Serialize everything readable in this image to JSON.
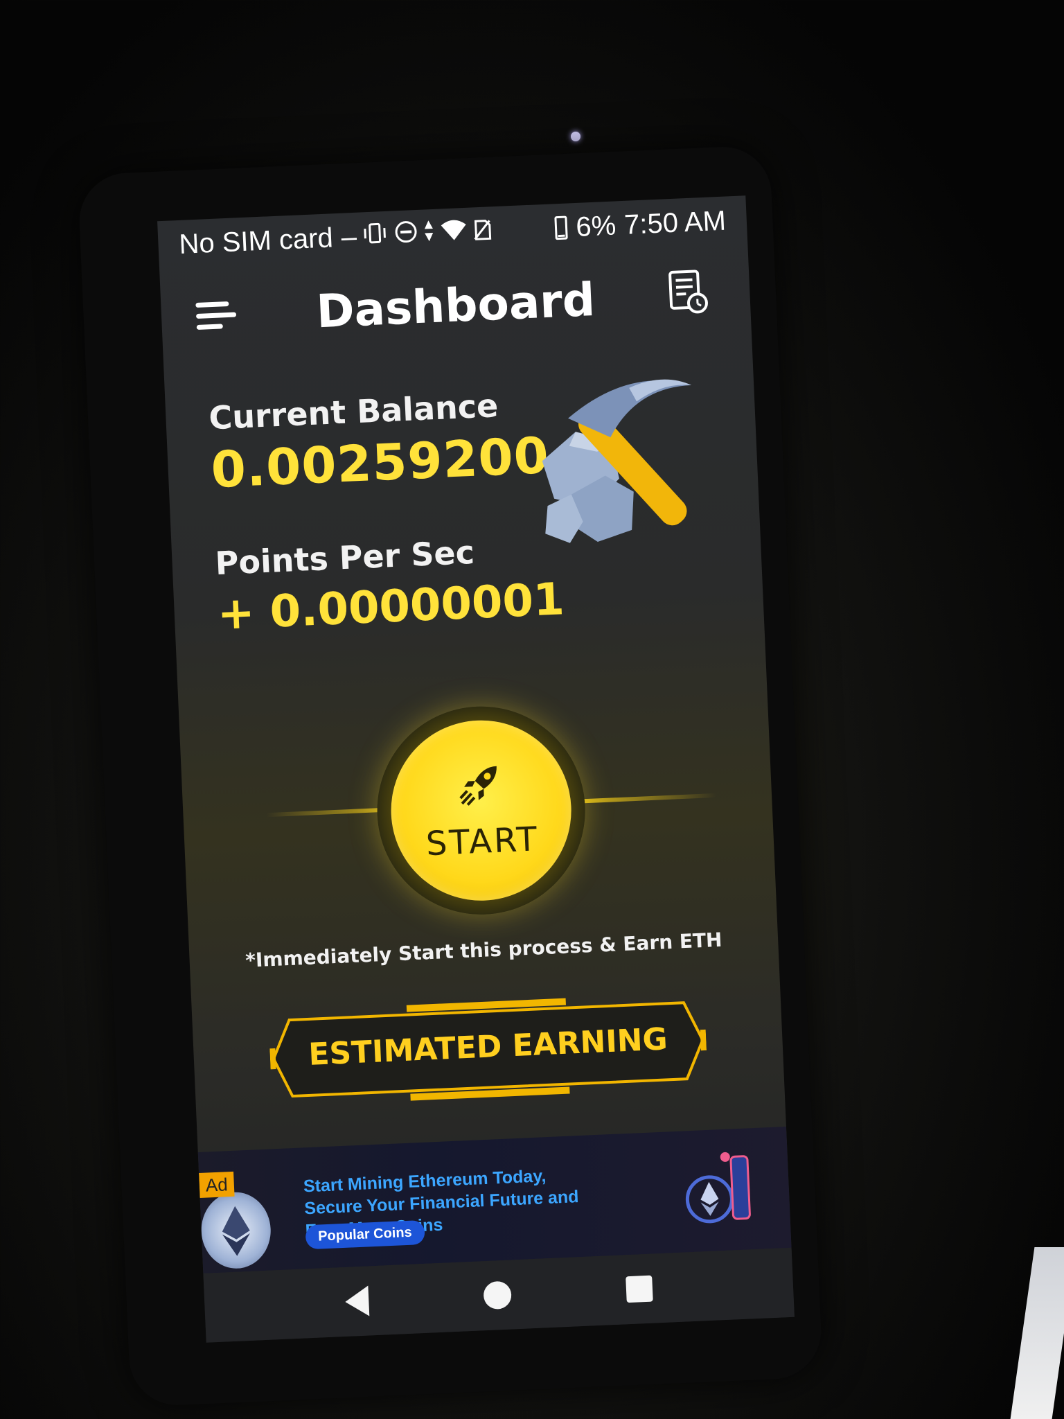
{
  "status_bar": {
    "carrier": "No SIM card",
    "separator": "–",
    "battery": "6%",
    "time": "7:50 AM",
    "icons": [
      "vibrate-icon",
      "dnd-icon",
      "data-arrows-icon",
      "wifi-icon",
      "no-sim-icon",
      "battery-icon"
    ]
  },
  "header": {
    "title": "Dashboard",
    "menu_icon": "menu-icon",
    "history_icon": "history-icon"
  },
  "balance": {
    "label": "Current Balance",
    "value": "0.00259200"
  },
  "points": {
    "label": "Points Per Sec",
    "value": "+ 0.00000001"
  },
  "start": {
    "label": "START",
    "icon": "rocket-icon"
  },
  "note": "*Immediately Start this process & Earn ETH",
  "estimated": {
    "label": "ESTIMATED EARNING"
  },
  "ad": {
    "badge": "Ad",
    "headline": "Start Mining Ethereum Today, Secure Your Financial Future and Earn More Coins",
    "cta": "Popular Coins"
  },
  "colors": {
    "accent": "#ffe23a",
    "button_yellow": "#ffd81a",
    "ad_link": "#3ca6ff",
    "ad_cta": "#1d55d8"
  }
}
